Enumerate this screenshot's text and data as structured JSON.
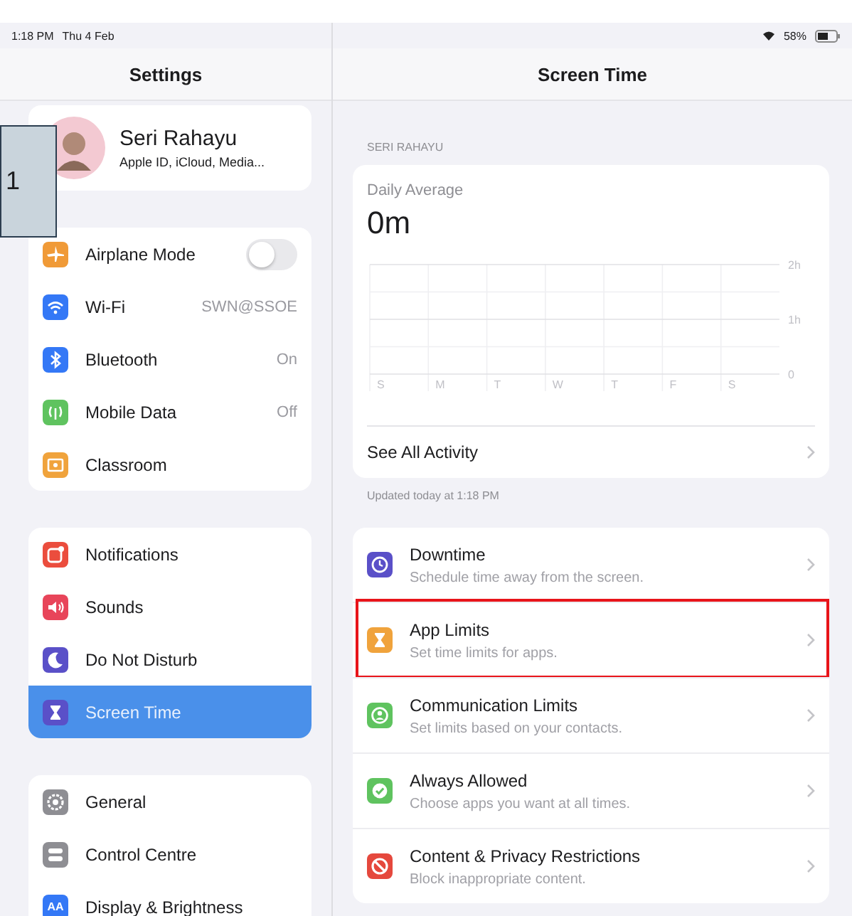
{
  "status_bar": {
    "time": "1:18 PM",
    "date": "Thu 4 Feb",
    "battery": "58%"
  },
  "sidebar": {
    "title": "Settings",
    "profile": {
      "name": "Seri Rahayu",
      "subtitle": "Apple ID, iCloud, Media..."
    },
    "groups": [
      {
        "items": [
          {
            "label": "Airplane Mode",
            "kind": "toggle",
            "on": false,
            "color": "#f09a37",
            "selected": false
          },
          {
            "label": "Wi-Fi",
            "kind": "value",
            "value": "SWN@SSOE",
            "color": "#3478f6",
            "selected": false
          },
          {
            "label": "Bluetooth",
            "kind": "value",
            "value": "On",
            "color": "#3478f6",
            "selected": false
          },
          {
            "label": "Mobile Data",
            "kind": "value",
            "value": "Off",
            "color": "#5fc35f",
            "selected": false
          },
          {
            "label": "Classroom",
            "kind": "plain",
            "color": "#f0a33c",
            "selected": false
          }
        ]
      },
      {
        "items": [
          {
            "label": "Notifications",
            "kind": "plain",
            "color": "#eb4d3d",
            "selected": false
          },
          {
            "label": "Sounds",
            "kind": "plain",
            "color": "#e8455a",
            "selected": false
          },
          {
            "label": "Do Not Disturb",
            "kind": "plain",
            "color": "#5a50c8",
            "selected": false
          },
          {
            "label": "Screen Time",
            "kind": "plain",
            "color": "#5a50c8",
            "selected": true
          }
        ]
      },
      {
        "items": [
          {
            "label": "General",
            "kind": "plain",
            "color": "#8e8e93",
            "selected": false
          },
          {
            "label": "Control Centre",
            "kind": "plain",
            "color": "#8e8e93",
            "selected": false
          },
          {
            "label": "Display & Brightness",
            "kind": "plain",
            "color": "#3478f6",
            "icon_text": "AA",
            "selected": false
          }
        ]
      }
    ]
  },
  "callout": {
    "label": "1"
  },
  "detail": {
    "title": "Screen Time",
    "section_label": "SERI RAHAYU",
    "summary": {
      "label": "Daily Average",
      "value": "0m",
      "chart_data": {
        "type": "bar",
        "categories": [
          "S",
          "M",
          "T",
          "W",
          "T",
          "F",
          "S"
        ],
        "values": [
          0,
          0,
          0,
          0,
          0,
          0,
          0
        ],
        "ylim": [
          0,
          2
        ],
        "yticks": [
          {
            "value": 0,
            "label": "0"
          },
          {
            "value": 1,
            "label": "1h"
          },
          {
            "value": 2,
            "label": "2h"
          }
        ]
      },
      "link": "See All Activity"
    },
    "updated": "Updated today at 1:18 PM",
    "options": [
      {
        "title": "Downtime",
        "subtitle": "Schedule time away from the screen.",
        "color": "#5a50c8",
        "highlighted": false
      },
      {
        "title": "App Limits",
        "subtitle": "Set time limits for apps.",
        "color": "#f0a33c",
        "highlighted": true
      },
      {
        "title": "Communication Limits",
        "subtitle": "Set limits based on your contacts.",
        "color": "#5fc35f",
        "highlighted": false
      },
      {
        "title": "Always Allowed",
        "subtitle": "Choose apps you want at all times.",
        "color": "#5fc35f",
        "highlighted": false
      },
      {
        "title": "Content & Privacy Restrictions",
        "subtitle": "Block inappropriate content.",
        "color": "#e5483d",
        "highlighted": false
      }
    ]
  }
}
